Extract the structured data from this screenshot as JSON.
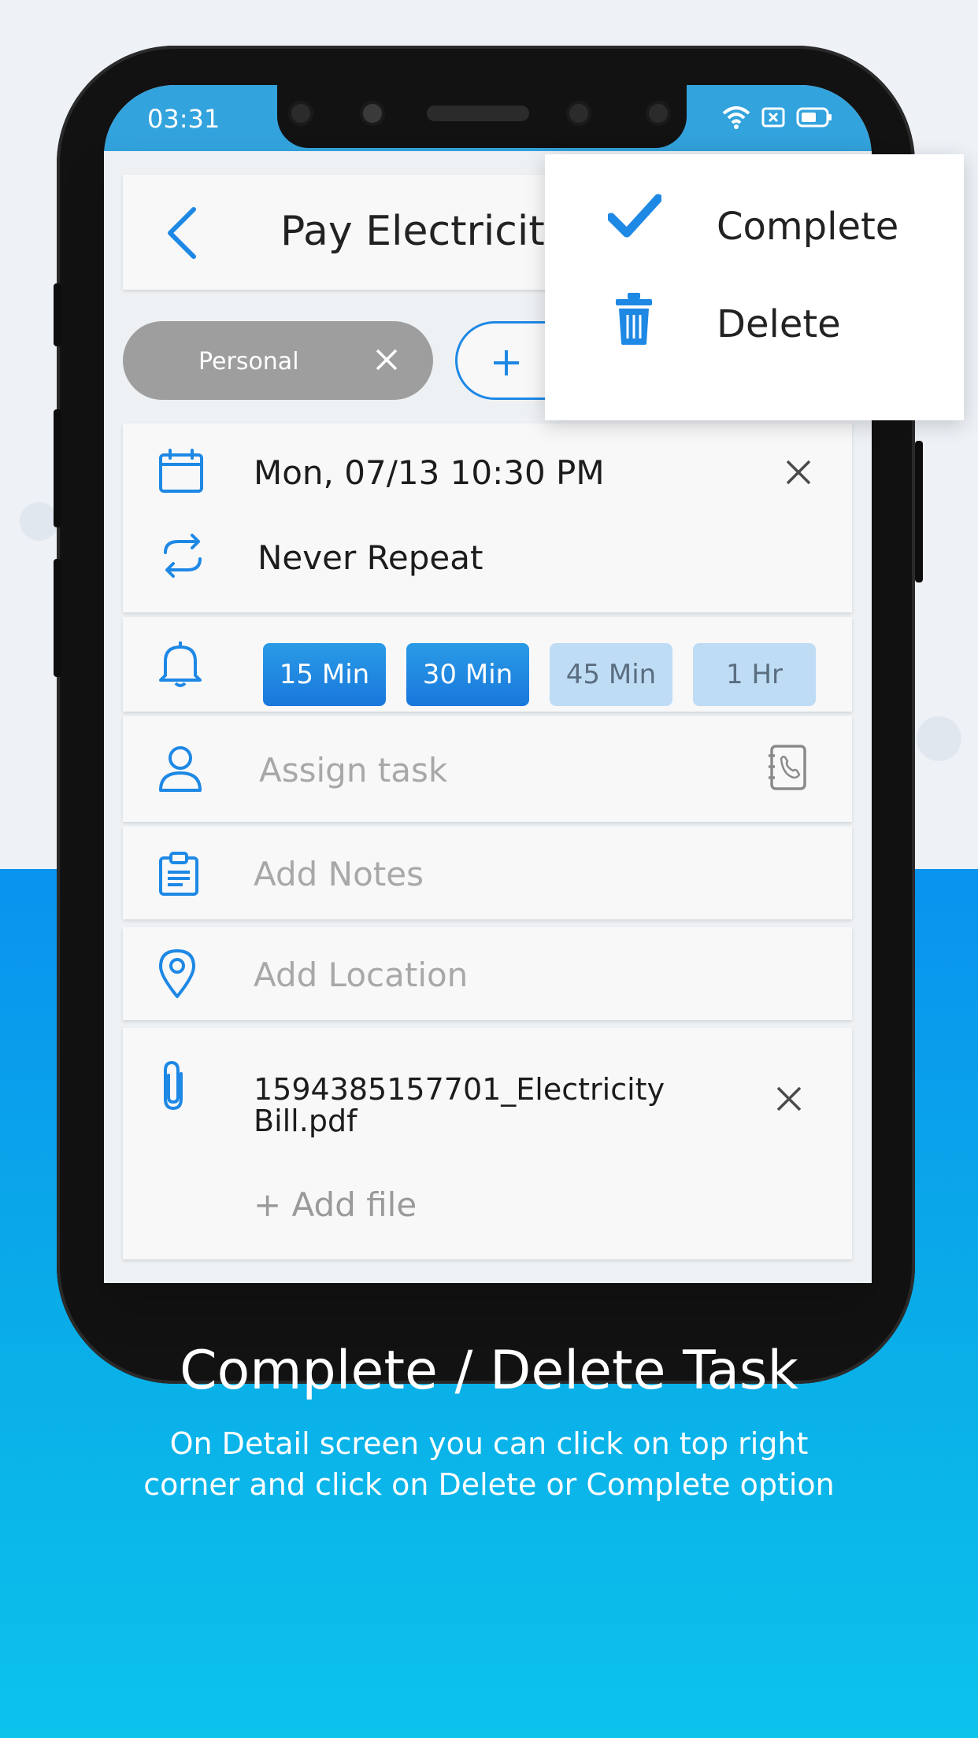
{
  "status_bar": {
    "time": "03:31"
  },
  "header": {
    "title": "Pay Electricity"
  },
  "tags": {
    "personal_label": "Personal"
  },
  "datetime": {
    "value": "Mon, 07/13 10:30 PM"
  },
  "repeat": {
    "value": "Never Repeat"
  },
  "reminders": {
    "options": [
      "15 Min",
      "30 Min",
      "45 Min",
      "1 Hr"
    ],
    "selected": [
      "15 Min",
      "30 Min"
    ]
  },
  "assign": {
    "placeholder": "Assign task"
  },
  "notes": {
    "placeholder": "Add Notes"
  },
  "location": {
    "placeholder": "Add Location"
  },
  "attachments": {
    "file_line1": "1594385157701_Electricity",
    "file_line2": "Bill.pdf",
    "add_file": "+ Add file"
  },
  "menu": {
    "complete_label": "Complete",
    "delete_label": "Delete"
  },
  "caption": {
    "title": "Complete / Delete Task",
    "line1": "On Detail screen you can click on top right",
    "line2": "corner and click on Delete or Complete option"
  },
  "colors": {
    "accent": "#1e88e5",
    "statusbar": "#33a3dd",
    "pill_active": "#1977dc",
    "pill_inactive": "#bfdcf5",
    "bg_gradient_top": "#0993ef",
    "bg_gradient_bottom": "#0cc3ec"
  }
}
